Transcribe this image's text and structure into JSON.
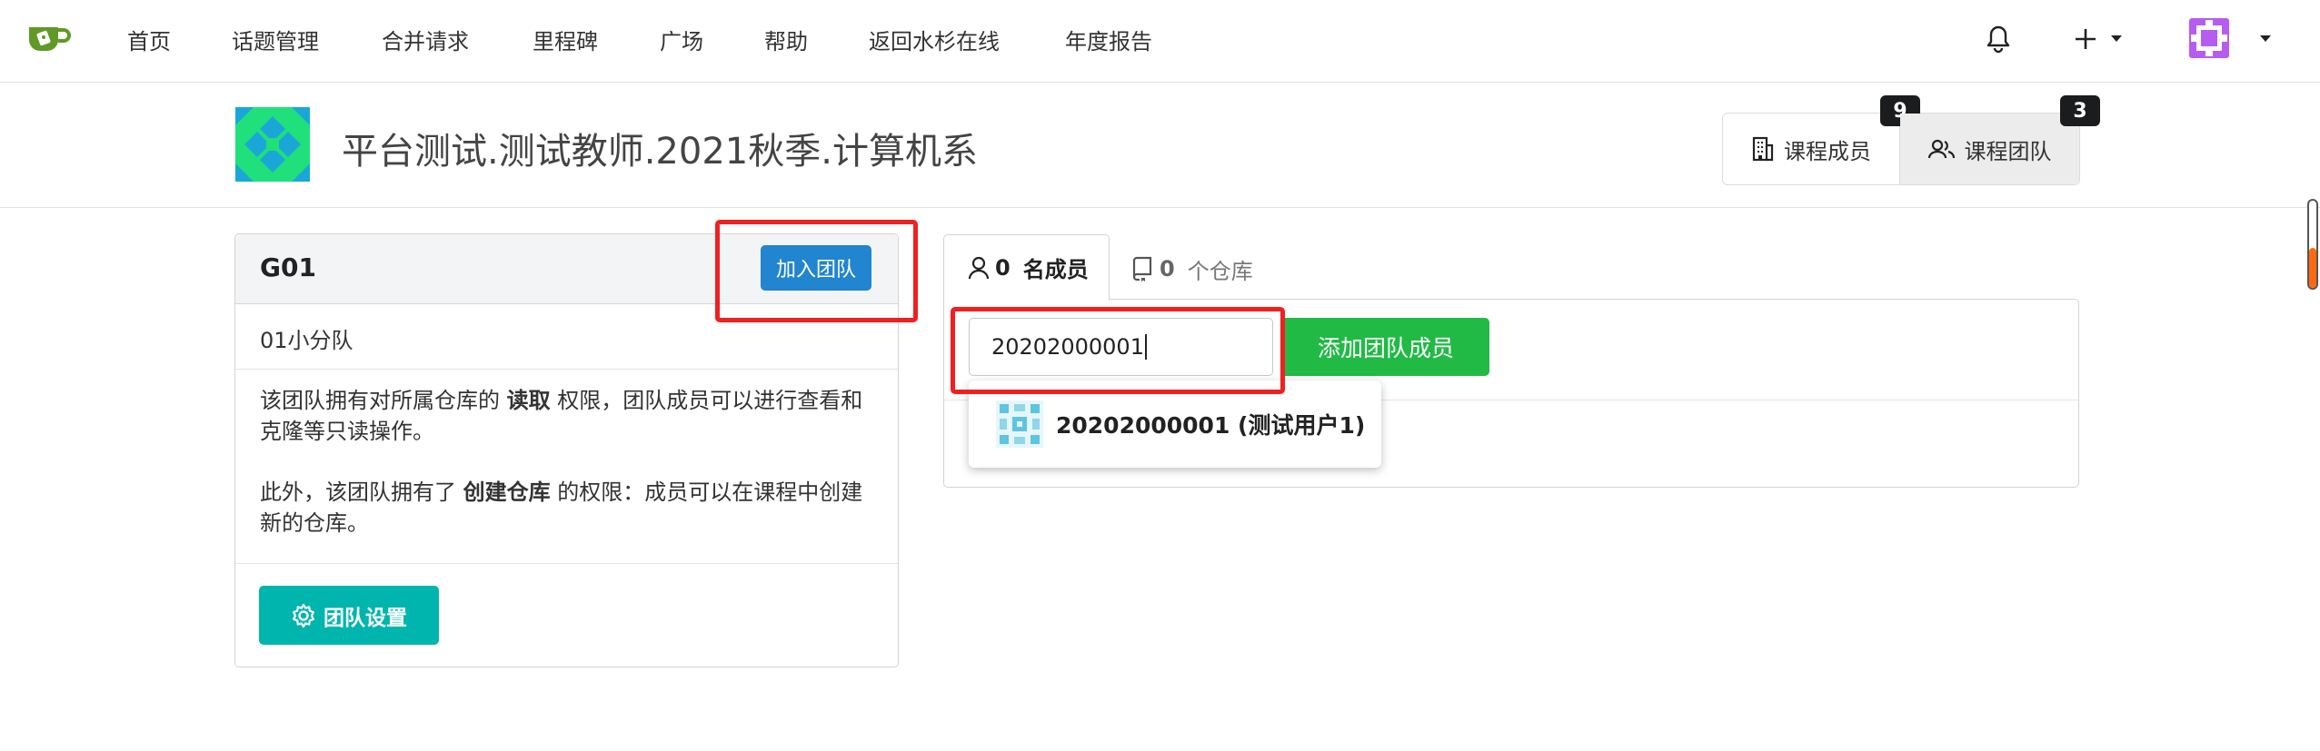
{
  "nav": {
    "items": [
      "首页",
      "话题管理",
      "合并请求",
      "里程碑",
      "广场",
      "帮助",
      "返回水杉在线",
      "年度报告"
    ],
    "notifications_icon": "bell-icon",
    "create_icon": "plus-icon",
    "user_menu_icon": "chevron-down-icon"
  },
  "org": {
    "title": "平台测试.测试教师.2021秋季.计算机系",
    "tabs": [
      {
        "label": "课程成员",
        "count": "9",
        "icon": "building-icon"
      },
      {
        "label": "课程团队",
        "count": "3",
        "icon": "people-icon"
      }
    ]
  },
  "team": {
    "name": "G01",
    "join_label": "加入团队",
    "description": "01小分队",
    "perm1_pre": "该团队拥有对所属仓库的 ",
    "perm1_bold": "读取",
    "perm1_post": " 权限，团队成员可以进行查看和克隆等只读操作。",
    "perm2_pre": "此外，该团队拥有了 ",
    "perm2_bold": "创建仓库",
    "perm2_post": " 的权限：成员可以在课程中创建新的仓库。",
    "settings_label": "团队设置"
  },
  "panel": {
    "members_count": "0",
    "members_label": "名成员",
    "repos_count": "0",
    "repos_label": "个仓库",
    "search_value": "20202000001",
    "add_button_label": "添加团队成员",
    "suggestion": "20202000001 (测试用户1)"
  },
  "colors": {
    "primary_blue": "#2185d0",
    "teal": "#00b5ad",
    "green": "#21ba45",
    "highlight_red": "#f02020"
  }
}
